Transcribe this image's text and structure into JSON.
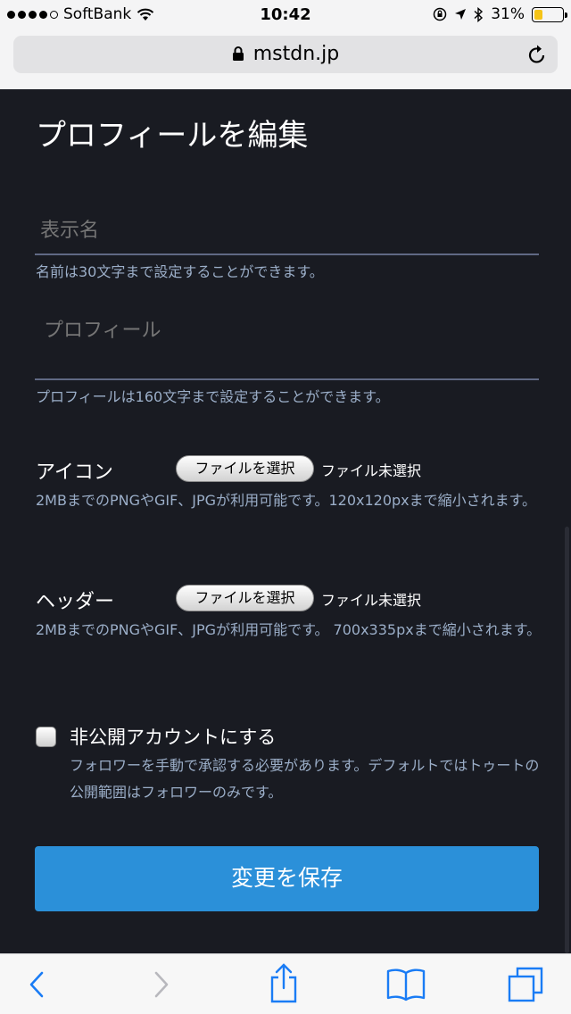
{
  "status_bar": {
    "carrier": "SoftBank",
    "time": "10:42",
    "battery_percent": "31%",
    "battery_level": 0.31
  },
  "browser": {
    "url": "mstdn.jp"
  },
  "page": {
    "title": "プロフィールを編集",
    "display_name": {
      "placeholder": "表示名",
      "value": "",
      "hint": "名前は30文字まで設定することができます。"
    },
    "bio": {
      "placeholder": "プロフィール",
      "value": "",
      "hint": "プロフィールは160文字まで設定することができます。"
    },
    "avatar": {
      "label": "アイコン",
      "button": "ファイルを選択",
      "status": "ファイル未選択",
      "description": "2MBまでのPNGやGIF、JPGが利用可能です。120x120pxまで縮小されます。"
    },
    "header": {
      "label": "ヘッダー",
      "button": "ファイルを選択",
      "status": "ファイル未選択",
      "description": "2MBまでのPNGやGIF、JPGが利用可能です。 700x335pxまで縮小されます。"
    },
    "locked": {
      "label": "非公開アカウントにする",
      "checked": false,
      "description": "フォロワーを手動で承認する必要があります。デフォルトではトゥートの公開範囲はフォロワーのみです。"
    },
    "save_label": "変更を保存"
  },
  "toolbar": {
    "icons": [
      "back-icon",
      "forward-icon",
      "share-icon",
      "bookmarks-icon",
      "tabs-icon"
    ]
  },
  "colors": {
    "background": "#191b22",
    "accent": "#2b90d9",
    "hint_text": "#9baec8",
    "field_underline": "#606984"
  }
}
